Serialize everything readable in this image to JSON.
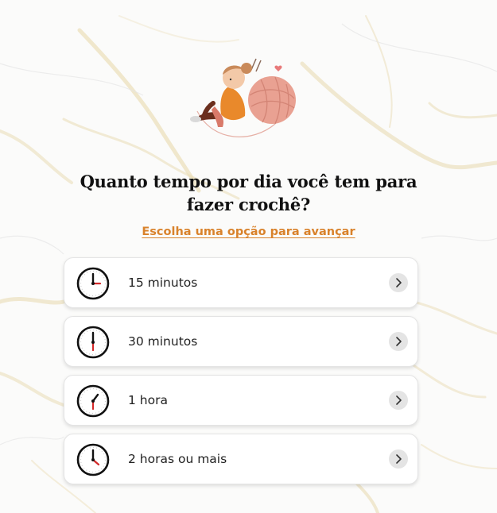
{
  "header": {
    "illustration_icon": "girl-with-yarn-ball-illustration",
    "title_line1": "Quanto tempo por dia você tem para",
    "title_line2": "fazer crochê?",
    "subtitle": "Escolha uma opção para avançar"
  },
  "options": [
    {
      "label": "15 minutos",
      "icon": "clock-icon",
      "chevron_icon": "chevron-right-icon"
    },
    {
      "label": "30 minutos",
      "icon": "clock-icon",
      "chevron_icon": "chevron-right-icon"
    },
    {
      "label": "1 hora",
      "icon": "clock-icon",
      "chevron_icon": "chevron-right-icon"
    },
    {
      "label": "2 horas ou mais",
      "icon": "clock-icon",
      "chevron_icon": "chevron-right-icon"
    }
  ],
  "colors": {
    "accent": "#d9822b",
    "title": "#111111",
    "background": "#fafafa",
    "marble_vein": "#e8cf95",
    "clock_hand": "#d42a2a"
  }
}
